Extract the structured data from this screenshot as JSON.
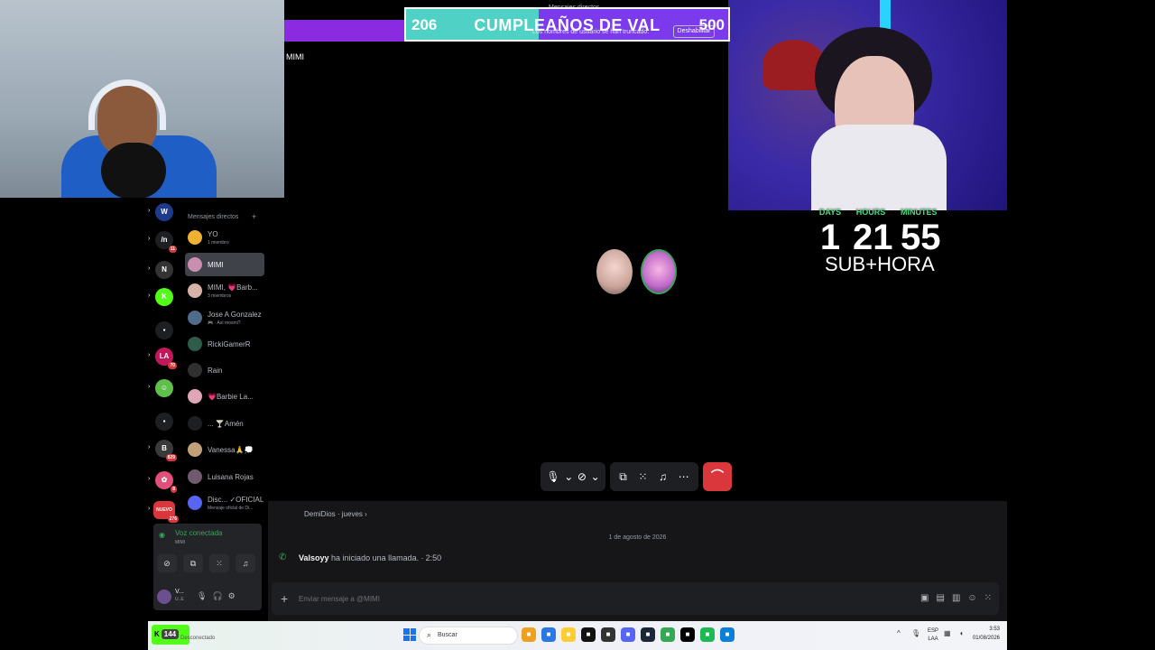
{
  "goal": {
    "start": "206",
    "title": "CUMPLEAÑOS DE VAL",
    "end": "500",
    "subtitle": "Los nombres de usuario se han truncado.",
    "button": "Deshabilitar",
    "window_title": "Mensajes directos"
  },
  "call": {
    "title": "MIMI"
  },
  "timer": {
    "days_label": "DAYS",
    "hours_label": "HOURS",
    "minutes_label": "MINUTES",
    "days": "1",
    "hours": "21",
    "minutes": "55",
    "sub": "SUB+HORA"
  },
  "chat": {
    "prev_message": "DemiDios · jueves ›",
    "date_divider": "1 de agosto de 2026",
    "call_user": "Valsoyy",
    "call_text": "ha iniciado una llamada. ∙ 2:50",
    "input_placeholder": "Enviar mensaje a @MIMI"
  },
  "dm_list": {
    "header": "Mensajes directos",
    "items": [
      {
        "name": "YO",
        "sub": "1 miembro",
        "color": "#f0b232"
      },
      {
        "name": "MIMI",
        "sub": "",
        "color": "#c98fb0",
        "active": true
      },
      {
        "name": "MIMI, 💗Barb...",
        "sub": "3 miembros",
        "color": "#d7b2a6"
      },
      {
        "name": "Jose A Gonzalez",
        "sub": "🎮 · Así mosmi?",
        "color": "#4e6b8a"
      },
      {
        "name": "RickiGamerR",
        "sub": "",
        "color": "#2f5b4a"
      },
      {
        "name": "Rain",
        "sub": "",
        "color": "#303030"
      },
      {
        "name": "💗Barbie La...",
        "sub": "",
        "color": "#e0a6b8"
      },
      {
        "name": "... 🍸Amén",
        "sub": "",
        "color": "#1e1f22"
      },
      {
        "name": "Vanessa🙏💭",
        "sub": "",
        "color": "#c2a07a"
      },
      {
        "name": "Luisana Rojas",
        "sub": "",
        "color": "#6f5a6e"
      },
      {
        "name": "Disc... ✓OFICIAL",
        "sub": "Mensaje oficial de Di...",
        "color": "#5865f2"
      }
    ]
  },
  "servers": [
    {
      "label": "W",
      "color": "#1e3a8a",
      "badge": ""
    },
    {
      "label": "/n",
      "color": "#1e1f22",
      "badge": "11"
    },
    {
      "label": "N",
      "color": "#333333",
      "badge": ""
    },
    {
      "label": "K",
      "color": "#53fc18",
      "badge": ""
    },
    {
      "label": "▪",
      "color": "#1e1f22",
      "badge": ""
    },
    {
      "label": "LA",
      "color": "#c2185b",
      "badge": "70"
    },
    {
      "label": "☺",
      "color": "#5fbf4a",
      "badge": ""
    },
    {
      "label": "▪",
      "color": "#1e1f22",
      "badge": ""
    },
    {
      "label": "B",
      "color": "#3a3a3a",
      "badge": "829"
    },
    {
      "label": "✿",
      "color": "#e0507a",
      "badge": "8"
    },
    {
      "label": "NUEVO",
      "color": "#da373c",
      "badge": "276"
    }
  ],
  "voice": {
    "status": "Voz conectada",
    "channel": "MIMI",
    "user": "V...",
    "user_sub": "U..E"
  },
  "taskbar": {
    "kick_count": "144",
    "kick_status": "Desconectado",
    "search": "Buscar",
    "lang": "ESP",
    "lang2": "LAA",
    "time": "3:53",
    "date": "01/08/2026",
    "apps": [
      {
        "icon": "files-icon",
        "color": "#f0a020"
      },
      {
        "icon": "store-icon",
        "color": "#2b78e4"
      },
      {
        "icon": "photos-icon",
        "color": "#ffcc33"
      },
      {
        "icon": "tiktok-icon",
        "color": "#111111"
      },
      {
        "icon": "obs-icon",
        "color": "#333333"
      },
      {
        "icon": "discord-icon",
        "color": "#5865f2"
      },
      {
        "icon": "steam-icon",
        "color": "#1b2838"
      },
      {
        "icon": "chrome-icon",
        "color": "#34a853"
      },
      {
        "icon": "capcut-icon",
        "color": "#000000"
      },
      {
        "icon": "spotify-icon",
        "color": "#1db954"
      },
      {
        "icon": "edge-icon",
        "color": "#0c7fd6"
      }
    ]
  }
}
